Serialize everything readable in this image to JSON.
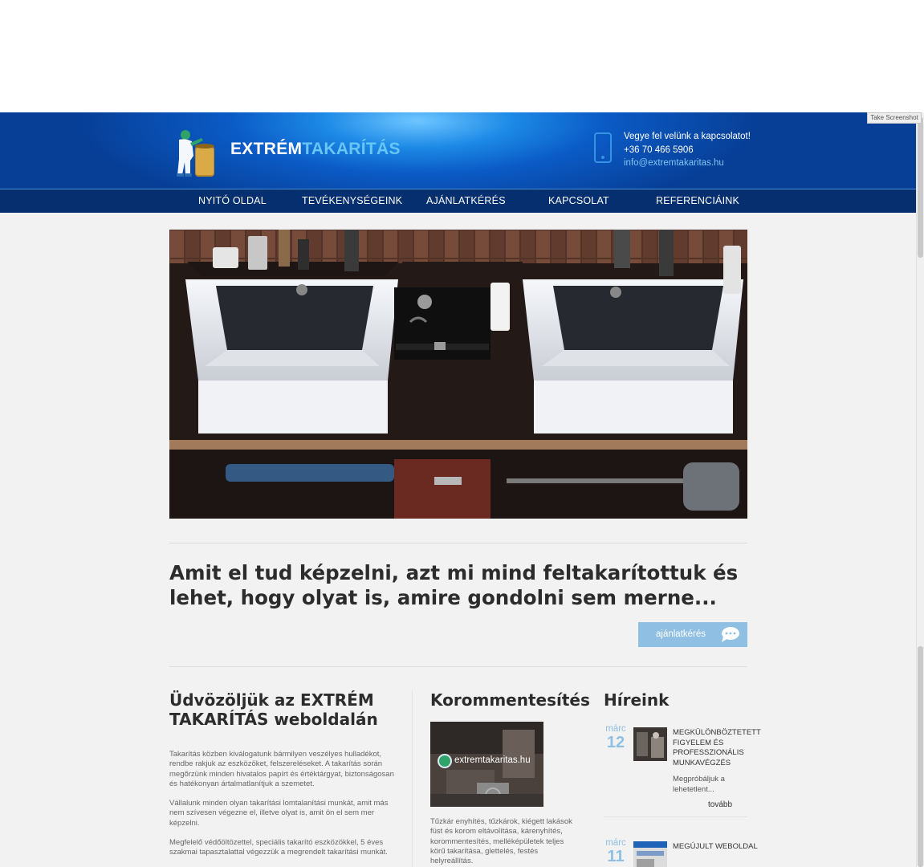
{
  "browser": {
    "take_screenshot_label": "Take Screenshot"
  },
  "header": {
    "logo_main": "EXTRÉM",
    "logo_accent": "TAKARÍTÁS",
    "contact_cta": "Vegye fel velünk a kapcsolatot!",
    "phone": "+36 70 466 5906",
    "email": "info@extremtakaritas.hu"
  },
  "nav": {
    "items": [
      {
        "label": "NYITÓ OLDAL"
      },
      {
        "label": "TEVÉKENYSÉGEINK"
      },
      {
        "label": "AJÁNLATKÉRÉS"
      },
      {
        "label": "KAPCSOLAT"
      },
      {
        "label": "REFERENCIÁINK"
      }
    ]
  },
  "hero": {
    "image_subject": "bathroom-double-sink-photo"
  },
  "tagline": {
    "text": "Amit el tud képzelni, azt mi mind feltakarítottuk és lehet, hogy olyat is, amire gondolni sem merne...",
    "button_label": "ajánlatkérés"
  },
  "welcome": {
    "title": "Üdvözöljük az EXTRÉM TAKARÍTÁS weboldalán",
    "paragraphs": [
      "Takarítás közben kiválogatunk bármilyen veszélyes hulladékot, rendbe rakjuk az eszközöket, felszereléseket. A takarítás során megőrzünk minden hivatalos papírt és értéktárgyat, biztonságosan és hatékonyan ártalmatlanítjuk a szemetet.",
      "Vállalunk minden olyan takarítási lomtalanítási munkát, amit más nem szívesen végezne el, illetve olyat is, amit ön el sem mer képzelni.",
      "Megfelelő védőöltözettel, speciális takarító eszközökkel, 5 éves szakmai tapasztalattal végezzük a megrendelt takarítási munkát."
    ]
  },
  "soot": {
    "title": "Korommentesítés",
    "image_watermark": "extremtakaritas.hu",
    "text": "Tűzkár enyhítés, tűzkárok, kiégett lakások füst és korom eltávolítása, kárenyhítés, korommentesítés, melléképületek teljes körű takarítása, glettelés, festés helyreállítás."
  },
  "news": {
    "title": "Híreink",
    "items": [
      {
        "month": "márc",
        "day": "12",
        "title": "MEGKÜLÖNBÖZTETETT FIGYELEM ÉS PROFESSZIONÁLIS MUNKAVÉGZÉS",
        "excerpt": "Megpróbáljuk a lehetetlent...",
        "more": "tovább"
      },
      {
        "month": "márc",
        "day": "11",
        "title": "MEGÚJULT WEBOLDAL"
      }
    ]
  },
  "colors": {
    "header_dark": "#073f97",
    "header_light": "#6fc6ff",
    "nav_bg": "#052f6e",
    "accent": "#67c6f5",
    "button_bg": "#8fbfe2",
    "page_bg": "#f2f2f2",
    "heading": "#2c2c2c"
  }
}
